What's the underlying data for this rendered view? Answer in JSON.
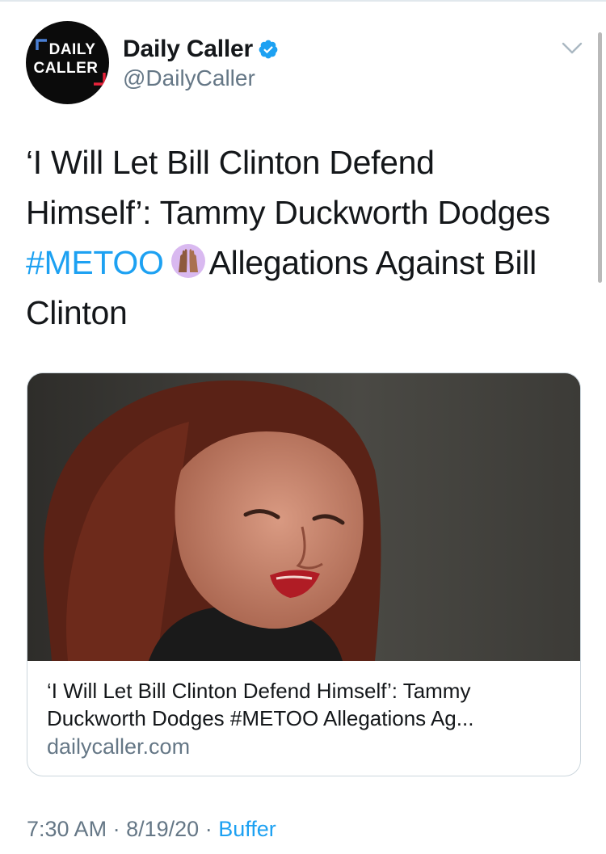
{
  "tweet": {
    "author": {
      "display_name": "Daily Caller",
      "handle": "@DailyCaller",
      "verified": true,
      "avatar_logo_lines": [
        "DAILY",
        "CALLER"
      ]
    },
    "text_lines": [
      {
        "plain": "‘I Will Let Bill Clinton Defend"
      },
      {
        "plain": "Himself’: Tammy Duckworth Dodges"
      },
      {
        "hashtag": "#METOO",
        "emoji": "raised-hands-emoji",
        "after": "Allegations Against Bill"
      },
      {
        "plain": "Clinton"
      }
    ],
    "card": {
      "title_lines": [
        "‘I Will Let Bill Clinton Defend Himself’: Tammy",
        "Duckworth Dodges #METOO Allegations Ag..."
      ],
      "domain": "dailycaller.com",
      "image_description_icon": "photo-of-woman"
    },
    "meta": {
      "time": "7:30 AM",
      "separator": "·",
      "date": "8/19/20",
      "source": "Buffer"
    }
  },
  "colors": {
    "link": "#1da1f2",
    "secondary_text": "#657786",
    "primary_text": "#14171a",
    "border": "#ccd6dd",
    "logo_red": "#e8233a",
    "logo_blue": "#4a7fd4"
  }
}
